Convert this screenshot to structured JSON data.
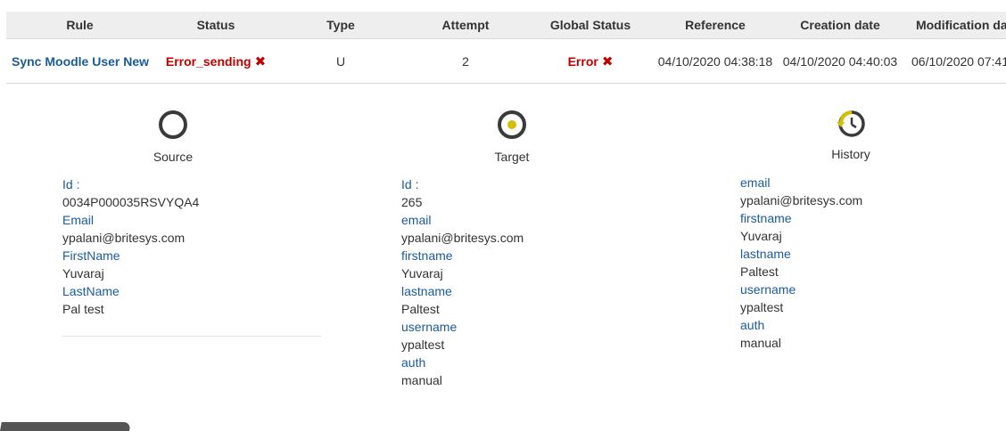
{
  "table": {
    "headers": [
      "Rule",
      "Status",
      "Type",
      "Attempt",
      "Global Status",
      "Reference",
      "Creation date",
      "Modification date"
    ],
    "row": {
      "rule": "Sync Moodle User New",
      "status": "Error_sending",
      "type": "U",
      "attempt": "2",
      "global_status": "Error",
      "reference": "04/10/2020 04:38:18",
      "creation_date": "04/10/2020 04:40:03",
      "modification_date": "06/10/2020 07:41"
    },
    "error_glyph": "✖"
  },
  "source": {
    "title": "Source",
    "icon": "circle-ring-icon",
    "fields": [
      {
        "key": "Id :",
        "value": "0034P000035RSVYQA4"
      },
      {
        "key": "Email",
        "value": "ypalani@britesys.com"
      },
      {
        "key": "FirstName",
        "value": "Yuvaraj"
      },
      {
        "key": "LastName",
        "value": "Pal test"
      }
    ]
  },
  "target": {
    "title": "Target",
    "icon": "target-dot-icon",
    "fields": [
      {
        "key": "Id :",
        "value": "265"
      },
      {
        "key": "email",
        "value": "ypalani@britesys.com"
      },
      {
        "key": "firstname",
        "value": "Yuvaraj"
      },
      {
        "key": "lastname",
        "value": "Paltest"
      },
      {
        "key": "username",
        "value": "ypaltest"
      },
      {
        "key": "auth",
        "value": "manual"
      }
    ]
  },
  "history": {
    "title": "History",
    "icon": "history-clock-icon",
    "fields": [
      {
        "key": "email",
        "value": "ypalani@britesys.com"
      },
      {
        "key": "firstname",
        "value": "Yuvaraj"
      },
      {
        "key": "lastname",
        "value": "Paltest"
      },
      {
        "key": "username",
        "value": "ypaltest"
      },
      {
        "key": "auth",
        "value": "manual"
      }
    ]
  },
  "colors": {
    "link": "#1b5b99",
    "error": "#c00000",
    "target_dot": "#d4c000",
    "header_bg": "#eeeeee"
  }
}
